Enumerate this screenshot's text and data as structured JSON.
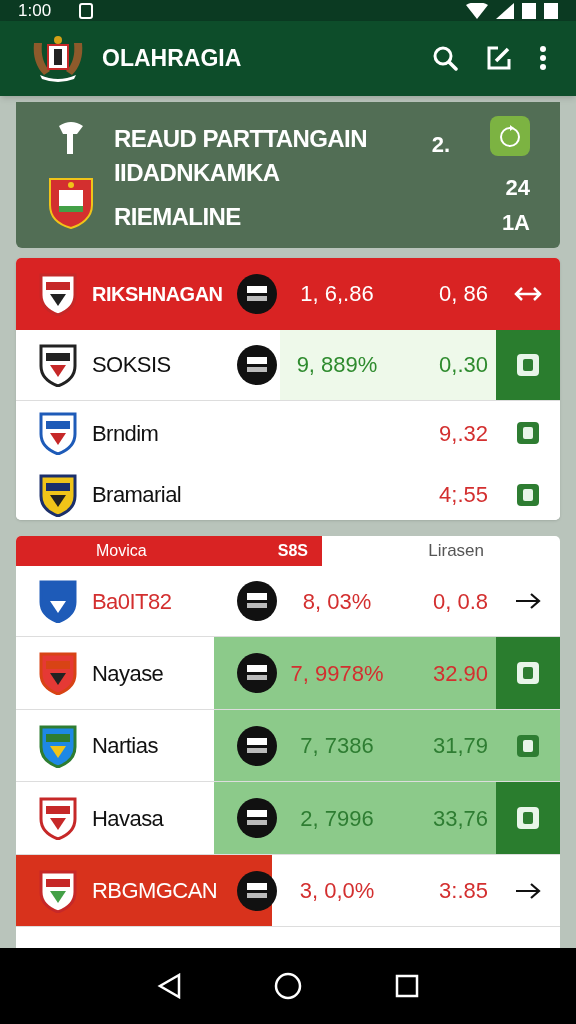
{
  "status_bar": {
    "time": "1:00"
  },
  "app_bar": {
    "title": "OLAHRAGIA"
  },
  "summary": {
    "lines": [
      "REAUD PARTTANGAIN",
      "IIDADNKAMKA",
      "RIEMALINE"
    ],
    "values": [
      "2.",
      "24",
      "1A"
    ]
  },
  "card_1": {
    "rows": [
      {
        "name": {
          "text": "RIKSHNAGAN",
          "color": "#ffffff"
        },
        "kind": "red",
        "value_1": "1, 6,.86",
        "value_2": "0, 86",
        "color": "#ffffff",
        "action": {
          "kind": "swap"
        },
        "mini_logo": true
      },
      {
        "name": {
          "text": "SOKSIS",
          "color": "#111111"
        },
        "kind": "faint",
        "value_1": "9, 889%",
        "value_2": "0,.30",
        "color": "#2e8b2e",
        "action": {
          "kind": "badge-dark"
        },
        "mini_logo": true
      },
      {
        "name": {
          "text": "Brndim",
          "color": "#111111"
        },
        "kind": "plain",
        "value_2": "9,.32",
        "color": "#d32f2f",
        "action": {
          "kind": "badge"
        },
        "mini_logo": false
      },
      {
        "name": {
          "text": "Bramarial",
          "color": "#111111"
        },
        "kind": "plain",
        "value_2": "4;.55",
        "color": "#d32f2f",
        "action": {
          "kind": "badge"
        },
        "mini_logo": false
      }
    ]
  },
  "card_2": {
    "header": {
      "tab": "Movica",
      "tab_value": "S8S",
      "label": "Lirasen"
    },
    "rows": [
      {
        "name": {
          "text": "Ba0IT82",
          "color": "#d32f2f"
        },
        "kind": "plain",
        "value_1": "8, 03%",
        "value_2": "0, 0.8",
        "color": "#d32f2f",
        "action": {
          "kind": "arrow"
        },
        "mini_logo": true
      },
      {
        "name": {
          "text": "Nayase",
          "color": "#111111"
        },
        "kind": "green",
        "value_1": "7, 9978%",
        "value_2": "32.90",
        "color": "#d32f2f",
        "action": {
          "kind": "badge-dark"
        },
        "mini_logo": true
      },
      {
        "name": {
          "text": "Nartias",
          "color": "#111111"
        },
        "kind": "green",
        "value_1": "7, 7386",
        "value_2": "31,79",
        "color": "#2e7d32",
        "action": {
          "kind": "badge"
        },
        "mini_logo": true
      },
      {
        "name": {
          "text": "Havasa",
          "color": "#111111"
        },
        "kind": "green",
        "value_1": "2, 7996",
        "value_2": "33,76",
        "color": "#2e7d32",
        "action": {
          "kind": "badge-dark"
        },
        "mini_logo": true
      },
      {
        "name": {
          "text": "RBGMGCAN",
          "color": "#ffffff"
        },
        "kind": "red-left",
        "value_1": "3, 0,0%",
        "value_2": "3:.85",
        "color": "#d32f2f",
        "action": {
          "kind": "arrow"
        },
        "mini_logo": true
      }
    ]
  }
}
